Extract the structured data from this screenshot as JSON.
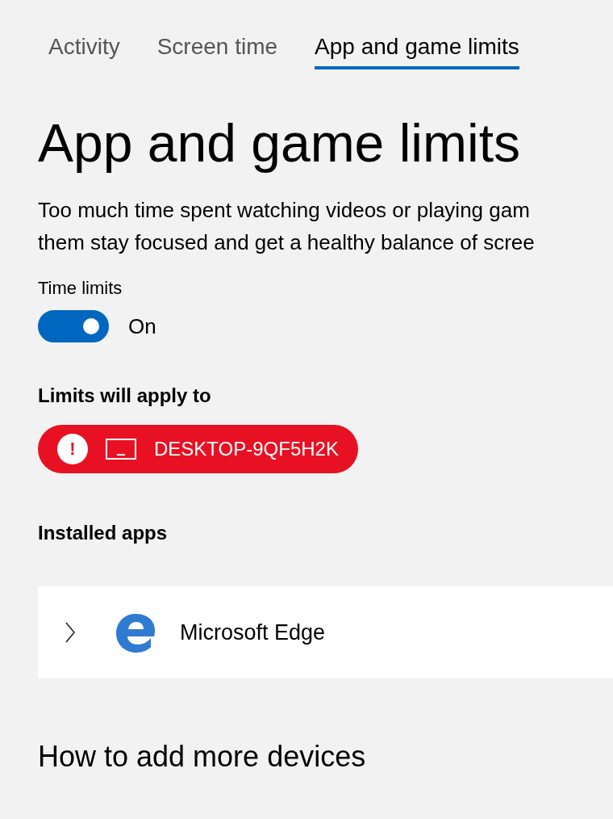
{
  "tabs": [
    {
      "label": "Activity",
      "selected": false
    },
    {
      "label": "Screen time",
      "selected": false
    },
    {
      "label": "App and game limits",
      "selected": true
    }
  ],
  "title": "App and game limits",
  "description": "Too much time spent watching videos or playing gam\nthem stay focused and get a healthy balance of scree",
  "time_limits": {
    "label": "Time limits",
    "on": true,
    "state_text": "On"
  },
  "limits_heading": "Limits will apply to",
  "device": {
    "alert": "!",
    "name": "DESKTOP-9QF5H2K"
  },
  "installed_apps_heading": "Installed apps",
  "apps": [
    {
      "name": "Microsoft Edge",
      "expanded": false
    }
  ],
  "more_devices_heading": "How to add more devices"
}
